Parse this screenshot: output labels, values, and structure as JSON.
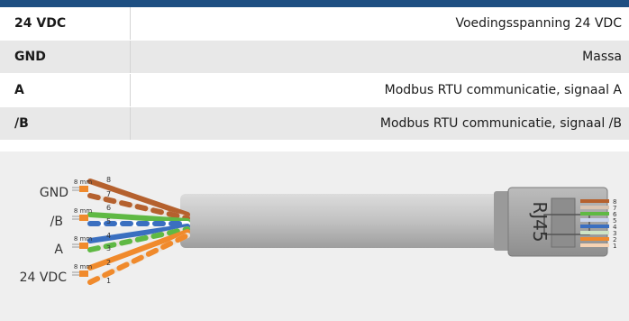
{
  "pins": [
    {
      "code": "24 VDC",
      "description": "Voedingsspanning 24 VDC"
    },
    {
      "code": "GND",
      "description": "Massa"
    },
    {
      "code": "A",
      "description": "Modbus RTU communicatie, signaal A"
    },
    {
      "code": "/B",
      "description": "Modbus RTU communicatie, signaal /B"
    }
  ],
  "diagram": {
    "wire_labels": [
      "GND",
      "/B",
      "A",
      "24 VDC"
    ],
    "strip_length": "8 mm",
    "wire_numbers": [
      "8",
      "7",
      "6",
      "5",
      "4",
      "3",
      "2",
      "1"
    ],
    "connector_label": "RJ45",
    "connector_pin_numbers": [
      "8",
      "7",
      "6",
      "5",
      "4",
      "3",
      "2",
      "1"
    ],
    "colors": {
      "brown": "#b5612e",
      "green": "#5fb944",
      "blue": "#3a6fc0",
      "orange": "#f08a2c",
      "cable": "#bdbdbd",
      "header": "#1e4f82"
    }
  }
}
